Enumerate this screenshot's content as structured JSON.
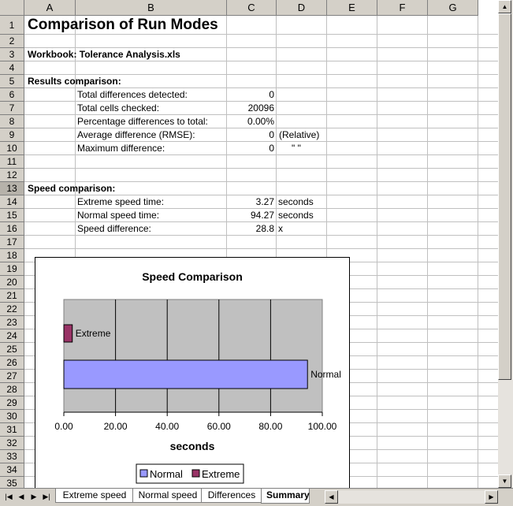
{
  "columns": [
    "A",
    "B",
    "C",
    "D",
    "E",
    "F",
    "G"
  ],
  "rows": [
    "1",
    "2",
    "3",
    "4",
    "5",
    "6",
    "7",
    "8",
    "9",
    "10",
    "11",
    "12",
    "13",
    "14",
    "15",
    "16",
    "17",
    "18",
    "19",
    "20",
    "21",
    "22",
    "23",
    "24",
    "25",
    "26",
    "27",
    "28",
    "29",
    "30",
    "31",
    "32",
    "33",
    "34",
    "35"
  ],
  "selected_row": "13",
  "cells": {
    "title": "Comparison of Run Modes",
    "workbook": "Workbook: Tolerance Analysis.xls",
    "results_heading": "Results comparison:",
    "total_diff_label": "Total differences detected:",
    "total_diff_value": "0",
    "total_cells_label": "Total cells checked:",
    "total_cells_value": "20096",
    "pct_label": "Percentage differences to total:",
    "pct_value": "0.00%",
    "avg_label": "Average difference (RMSE):",
    "avg_value": "0",
    "avg_note": "(Relative)",
    "max_label": "Maximum difference:",
    "max_value": "0",
    "max_note": "\"     \"",
    "speed_heading": "Speed comparison:",
    "extreme_label": "Extreme speed time:",
    "extreme_value": "3.27",
    "extreme_unit": "seconds",
    "normal_label": "Normal speed time:",
    "normal_value": "94.27",
    "normal_unit": "seconds",
    "diff_label": "Speed difference:",
    "diff_value": "28.8",
    "diff_unit": "x"
  },
  "chart_data": {
    "type": "bar",
    "orientation": "horizontal",
    "title": "Speed Comparison",
    "xlabel": "seconds",
    "categories": [
      "Extreme",
      "Normal"
    ],
    "values": [
      3.27,
      94.27
    ],
    "colors": [
      "#993366",
      "#9999ff"
    ],
    "xlim": [
      0,
      100
    ],
    "xticks": [
      "0.00",
      "20.00",
      "40.00",
      "60.00",
      "80.00",
      "100.00"
    ],
    "plot_background": "#c0c0c0",
    "legend": {
      "placement": "bottom",
      "entries": [
        "Normal",
        "Extreme"
      ]
    }
  },
  "sheet_tabs": [
    "Extreme speed",
    "Normal speed",
    "Differences",
    "Summary"
  ],
  "active_tab": "Summary"
}
